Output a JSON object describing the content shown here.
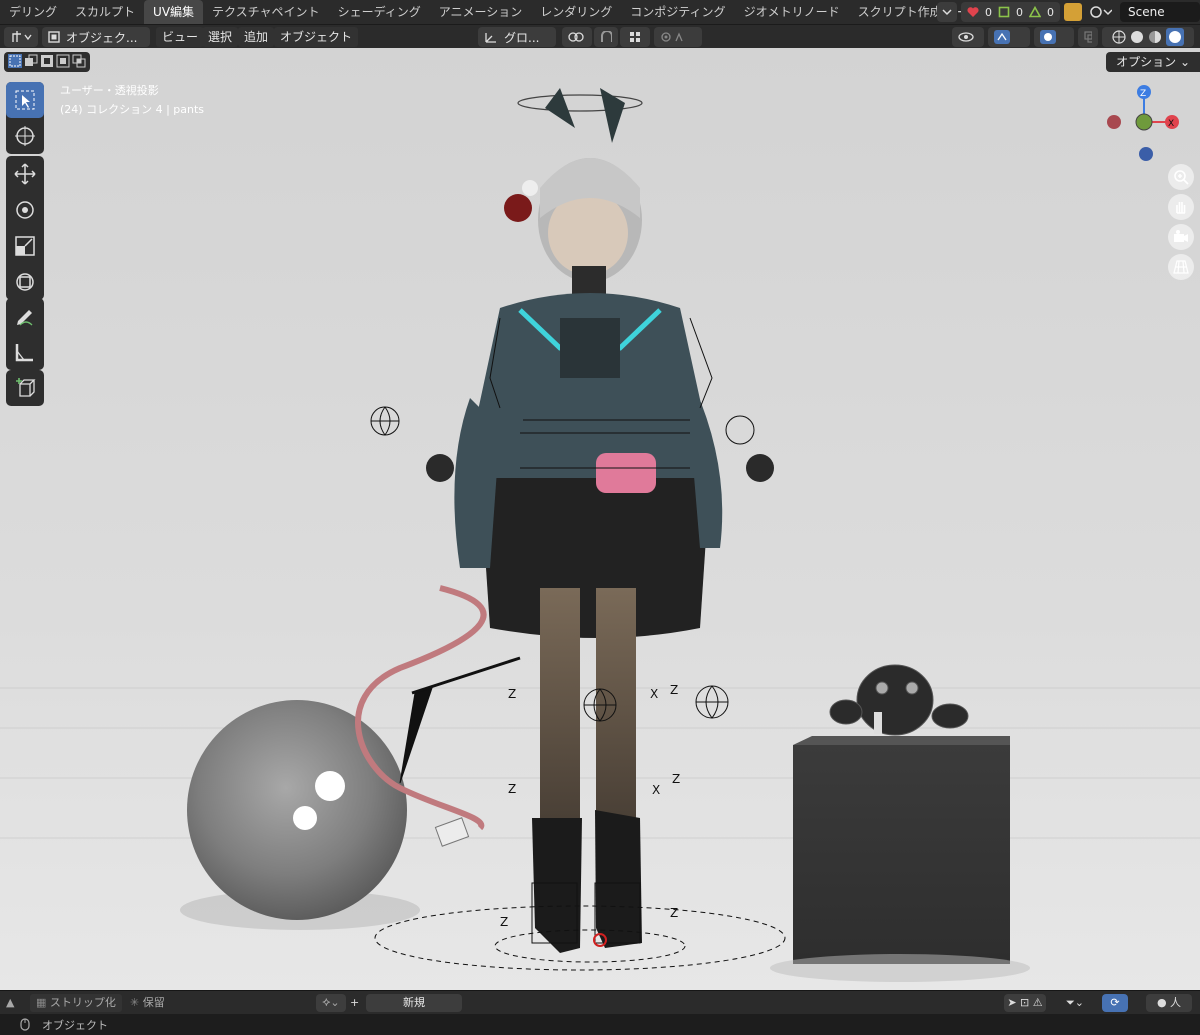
{
  "workspace_tabs": [
    "デリング",
    "スカルプト",
    "UV編集",
    "テクスチャペイント",
    "シェーディング",
    "アニメーション",
    "レンダリング",
    "コンポジティング",
    "ジオメトリノード",
    "スクリプト作成"
  ],
  "active_tab": "UV編集",
  "add_tab_symbol": "+",
  "stats": {
    "heart": "0",
    "square": "0",
    "triangle": "0"
  },
  "scene_name": "Scene",
  "header": {
    "mode": "オブジェク...",
    "menus": [
      "ビュー",
      "選択",
      "追加",
      "オブジェクト"
    ],
    "transform_orientation": "グロ..."
  },
  "viewport": {
    "view_label": "ユーザー・透視投影",
    "collection_label": "(24) コレクション 4 | pants",
    "options_label": "オプション",
    "gizmo": {
      "z": "Z",
      "x": "X"
    }
  },
  "timeline": {
    "strip_label": "ストリップ化",
    "keep_label": "保留",
    "new_label": "新規"
  },
  "status": {
    "mode_label": "オブジェクト"
  },
  "colors": {
    "accent": "#4772b3",
    "gizmo_x": "#e0434d",
    "gizmo_y": "#8bc34a",
    "gizmo_z": "#3d7de2"
  }
}
